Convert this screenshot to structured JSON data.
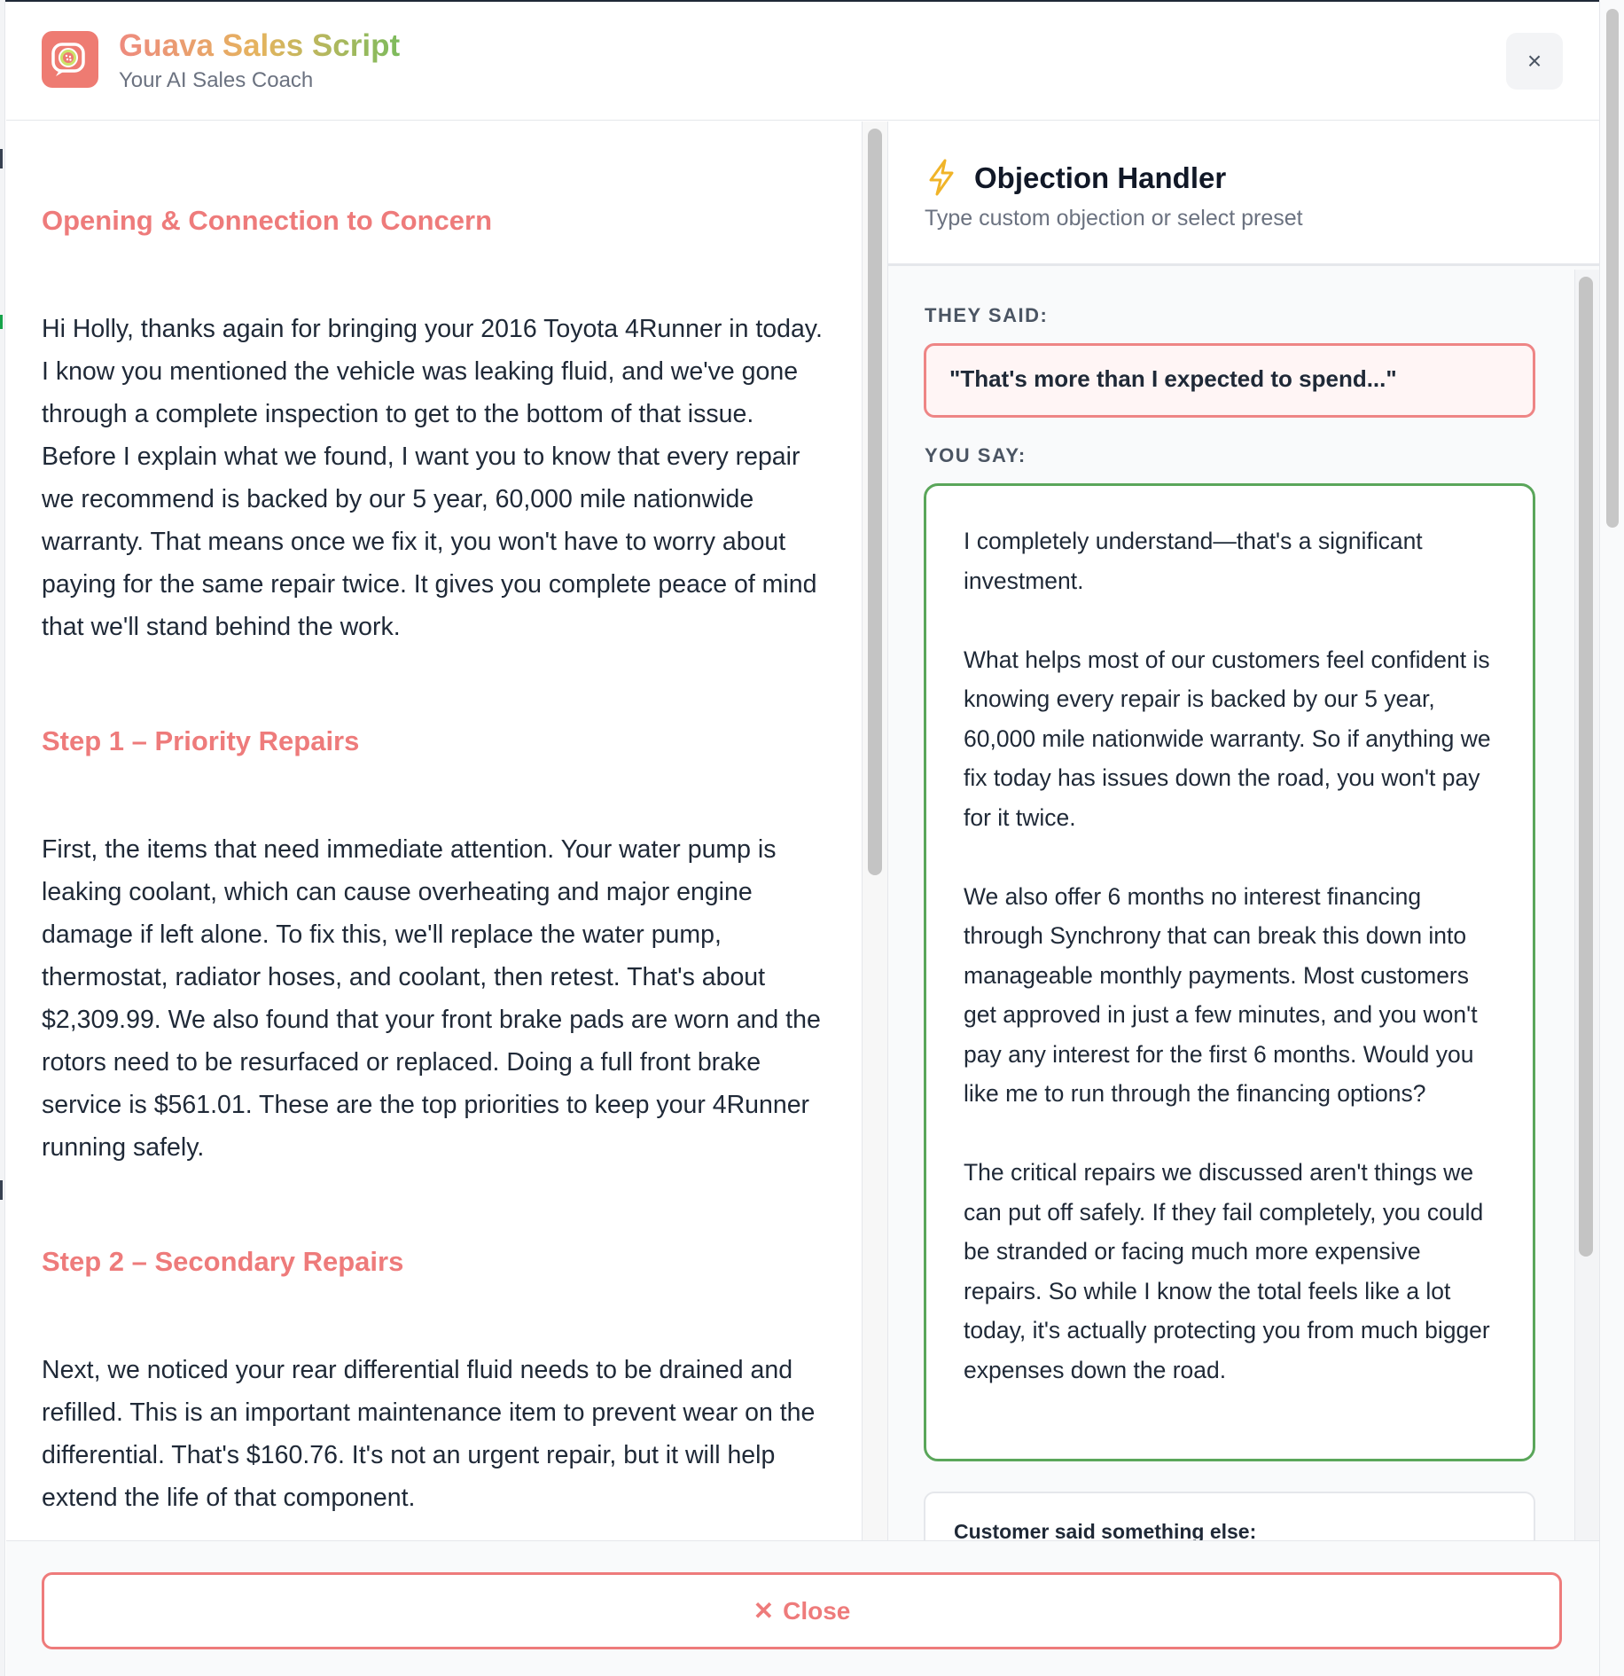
{
  "app": {
    "title": "Guava Sales Script",
    "subtitle": "Your AI Sales Coach",
    "close_icon": "×",
    "accent_color": "#ee7b7b"
  },
  "script": {
    "sections": [
      {
        "heading": "Opening & Connection to Concern",
        "body": "Hi Holly, thanks again for bringing your 2016 Toyota 4Runner in today. I know you mentioned the vehicle was leaking fluid, and we've gone through a complete inspection to get to the bottom of that issue. Before I explain what we found, I want you to know that every repair we recommend is backed by our 5 year, 60,000 mile nationwide warranty. That means once we fix it, you won't have to worry about paying for the same repair twice. It gives you complete peace of mind that we'll stand behind the work."
      },
      {
        "heading": "Step 1 – Priority Repairs",
        "body": "First, the items that need immediate attention. Your water pump is leaking coolant, which can cause overheating and major engine damage if left alone. To fix this, we'll replace the water pump, thermostat, radiator hoses, and coolant, then retest. That's about $2,309.99. We also found that your front brake pads are worn and the rotors need to be resurfaced or replaced. Doing a full front brake service is $561.01. These are the top priorities to keep your 4Runner running safely."
      },
      {
        "heading": "Step 2 – Secondary Repairs",
        "body": "Next, we noticed your rear differential fluid needs to be drained and refilled. This is an important maintenance item to prevent wear on the differential. That's $160.76. It's not an urgent repair, but it will help extend the life of that component."
      }
    ]
  },
  "objection_handler": {
    "title": "Objection Handler",
    "subtitle": "Type custom objection or select preset",
    "they_said_label": "THEY SAID:",
    "they_said": "\"That's more than I expected to spend...\"",
    "you_say_label": "YOU SAY:",
    "you_say": [
      "I completely understand—that's a significant investment.",
      "What helps most of our customers feel confident is knowing every repair is backed by our 5 year, 60,000 mile nationwide warranty. So if anything we fix today has issues down the road, you won't pay for it twice.",
      "We also offer 6 months no interest financing through Synchrony that can break this down into manageable monthly payments. Most customers get approved in just a few minutes, and you won't pay any interest for the first 6 months. Would you like me to run through the financing options?",
      "The critical repairs we discussed aren't things we can put off safely. If they fail completely, you could be stranded or facing much more expensive repairs. So while I know the total feels like a lot today, it's actually protecting you from much bigger expenses down the road."
    ],
    "customer_else_label": "Customer said something else:"
  },
  "footer": {
    "close_icon": "✕",
    "close_label": "Close"
  }
}
